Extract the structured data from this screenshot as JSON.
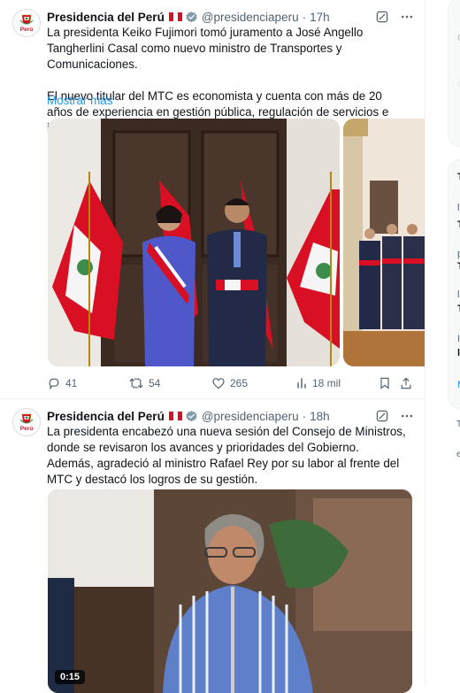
{
  "tweets": [
    {
      "author_name": "Presidencia del Perú",
      "handle": "@presidenciaperu",
      "separator": "·",
      "time": "17h",
      "text": "La presidenta Keiko Fujimori tomó juramento a José Angello Tangherlini Casal como nuevo ministro de Transportes y Comunicaciones.\n\nEl nuevo titular del MTC es economista y cuenta con más de 20 años de experiencia en gestión pública, regulación de servicios e infraestructura de",
      "show_more": "Mostrar más",
      "stats": {
        "replies": "41",
        "reposts": "54",
        "likes": "265",
        "views": "18 mil"
      }
    },
    {
      "author_name": "Presidencia del Perú",
      "handle": "@presidenciaperu",
      "separator": "·",
      "time": "18h",
      "text": "La presidenta encabezó una nueva sesión del Consejo de Ministros, donde se revisaron los avances y prioridades del Gobierno. Además, agradeció al ministro Rafael Rey por su labor al frente del MTC y destacó los logros de su gestión.",
      "video_duration": "0:15"
    }
  ],
  "avatar_label": "Perú",
  "sidebar_fragments": [
    "C",
    "T",
    "l",
    "T",
    "p",
    "T",
    "l",
    "T",
    "I",
    "l",
    "T",
    "e"
  ],
  "colors": {
    "accent": "#1d9bf0",
    "secondary_text": "#536471",
    "peru_red": "#d91023",
    "verified": "#829aab"
  },
  "icons": [
    "grok-icon",
    "more-icon",
    "reply-icon",
    "repost-icon",
    "like-icon",
    "views-icon",
    "bookmark-icon",
    "share-icon"
  ]
}
